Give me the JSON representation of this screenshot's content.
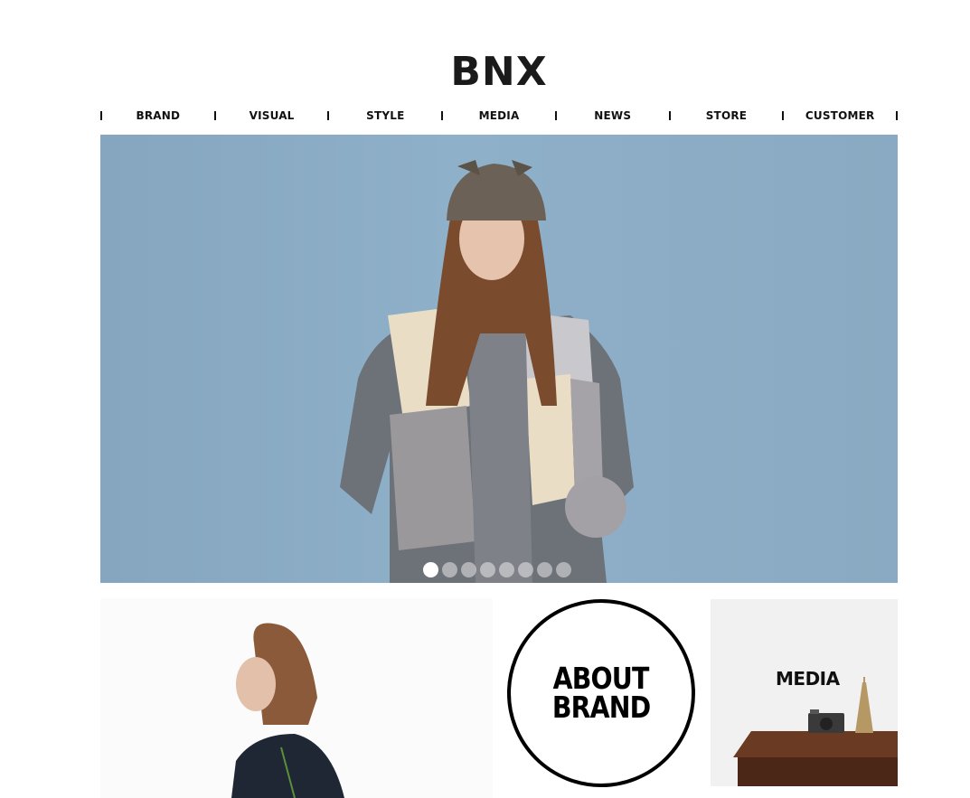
{
  "brand": {
    "logo_text": "BNX"
  },
  "nav": {
    "items": [
      {
        "label": "BRAND"
      },
      {
        "label": "VISUAL"
      },
      {
        "label": "STYLE"
      },
      {
        "label": "MEDIA"
      },
      {
        "label": "NEWS"
      },
      {
        "label": "STORE"
      },
      {
        "label": "CUSTOMER"
      }
    ]
  },
  "hero": {
    "slide_count": 8,
    "active_slide": 1,
    "background_color": "#8fb0c9"
  },
  "tiles": {
    "about": {
      "line1": "ABOUT",
      "line2": "BRAND"
    },
    "media": {
      "label": "MEDIA"
    }
  }
}
